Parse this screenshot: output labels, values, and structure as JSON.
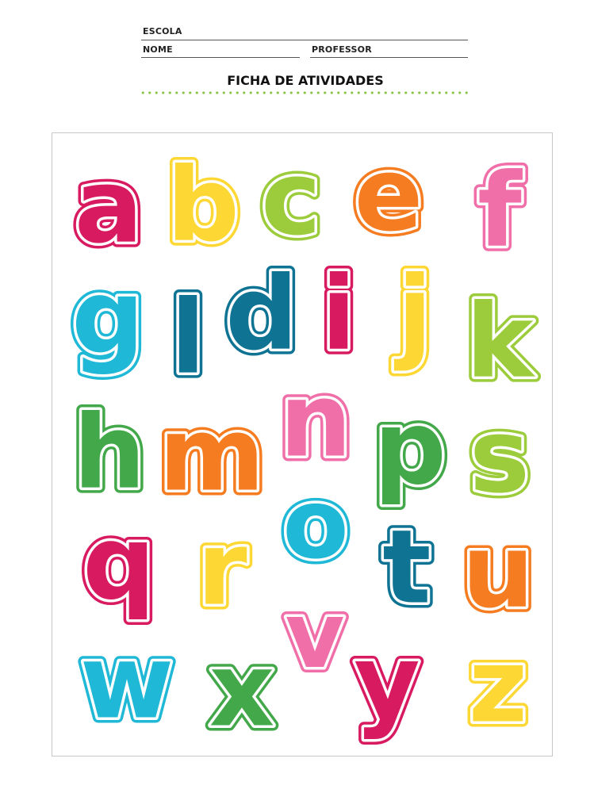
{
  "header": {
    "school_label": "ESCOLA",
    "name_label": "NOME",
    "teacher_label": "PROFESSOR",
    "title": "FICHA DE ATIVIDADES"
  },
  "alphabet": [
    {
      "char": "a",
      "color": "#d81b60"
    },
    {
      "char": "b",
      "color": "#fdd835"
    },
    {
      "char": "c",
      "color": "#9ccc3c"
    },
    {
      "char": "e",
      "color": "#f57c20"
    },
    {
      "char": "f",
      "color": "#f06fa8"
    },
    {
      "char": "g",
      "color": "#1fb8d6"
    },
    {
      "char": "l",
      "color": "#0f7394"
    },
    {
      "char": "d",
      "color": "#0f7394"
    },
    {
      "char": "i",
      "color": "#d81b60"
    },
    {
      "char": "j",
      "color": "#fdd835"
    },
    {
      "char": "k",
      "color": "#9ccc3c"
    },
    {
      "char": "h",
      "color": "#43a84a"
    },
    {
      "char": "m",
      "color": "#f57c20"
    },
    {
      "char": "n",
      "color": "#f06fa8"
    },
    {
      "char": "p",
      "color": "#43a84a"
    },
    {
      "char": "s",
      "color": "#9ccc3c"
    },
    {
      "char": "q",
      "color": "#d81b60"
    },
    {
      "char": "r",
      "color": "#fdd835"
    },
    {
      "char": "o",
      "color": "#1fb8d6"
    },
    {
      "char": "t",
      "color": "#0f7394"
    },
    {
      "char": "u",
      "color": "#f57c20"
    },
    {
      "char": "v",
      "color": "#f06fa8"
    },
    {
      "char": "w",
      "color": "#1fb8d6"
    },
    {
      "char": "x",
      "color": "#43a84a"
    },
    {
      "char": "y",
      "color": "#d81b60"
    },
    {
      "char": "z",
      "color": "#fdd835"
    }
  ]
}
